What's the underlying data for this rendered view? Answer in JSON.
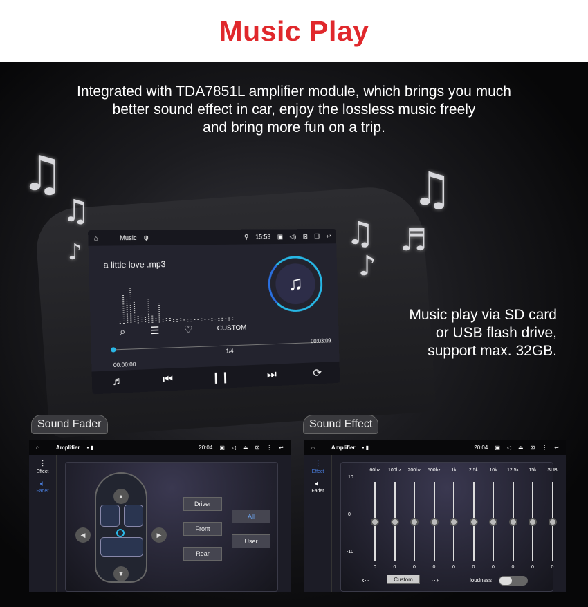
{
  "header": {
    "title": "Music Play"
  },
  "description": [
    "Integrated with TDA7851L amplifier module, which brings you much",
    "better sound effect in car, enjoy the lossless music freely",
    "and bring more fun on a trip."
  ],
  "side_text": [
    "Music play via SD card",
    "or USB flash drive,",
    "support max. 32GB."
  ],
  "music_screen": {
    "app": "Music",
    "time": "15:53",
    "song": "a little love .mp3",
    "mode": "CUSTOM",
    "elapsed": "00:00:00",
    "duration": "00:03:09",
    "track": "1/4",
    "progress": 0,
    "accent": "#27b7e6"
  },
  "sound_fader": {
    "tab": "Sound Fader",
    "app": "Amplifier",
    "time": "20:04",
    "side": [
      "Effect",
      "Fader"
    ],
    "active_side": "Fader",
    "buttons": [
      "Driver",
      "Front",
      "Rear",
      "All",
      "User"
    ],
    "selected": "All"
  },
  "sound_effect": {
    "tab": "Sound Effect",
    "app": "Amplifier",
    "time": "20:04",
    "side": [
      "Effect",
      "Fader"
    ],
    "active_side": "Effect",
    "scale": [
      "10",
      "0",
      "-10"
    ],
    "bands": [
      {
        "label": "60hz",
        "value": 0
      },
      {
        "label": "100hz",
        "value": 0
      },
      {
        "label": "200hz",
        "value": 0
      },
      {
        "label": "500hz",
        "value": 0
      },
      {
        "label": "1k",
        "value": 0
      },
      {
        "label": "2.5k",
        "value": 0
      },
      {
        "label": "10k",
        "value": 0
      },
      {
        "label": "12.5k",
        "value": 0
      },
      {
        "label": "15k",
        "value": 0
      },
      {
        "label": "SUB",
        "value": 0
      }
    ],
    "preset": "Custom",
    "loudness_label": "loudness",
    "loudness_on": false
  },
  "colors": {
    "title": "#e0282c",
    "active": "#4a7fe0"
  }
}
